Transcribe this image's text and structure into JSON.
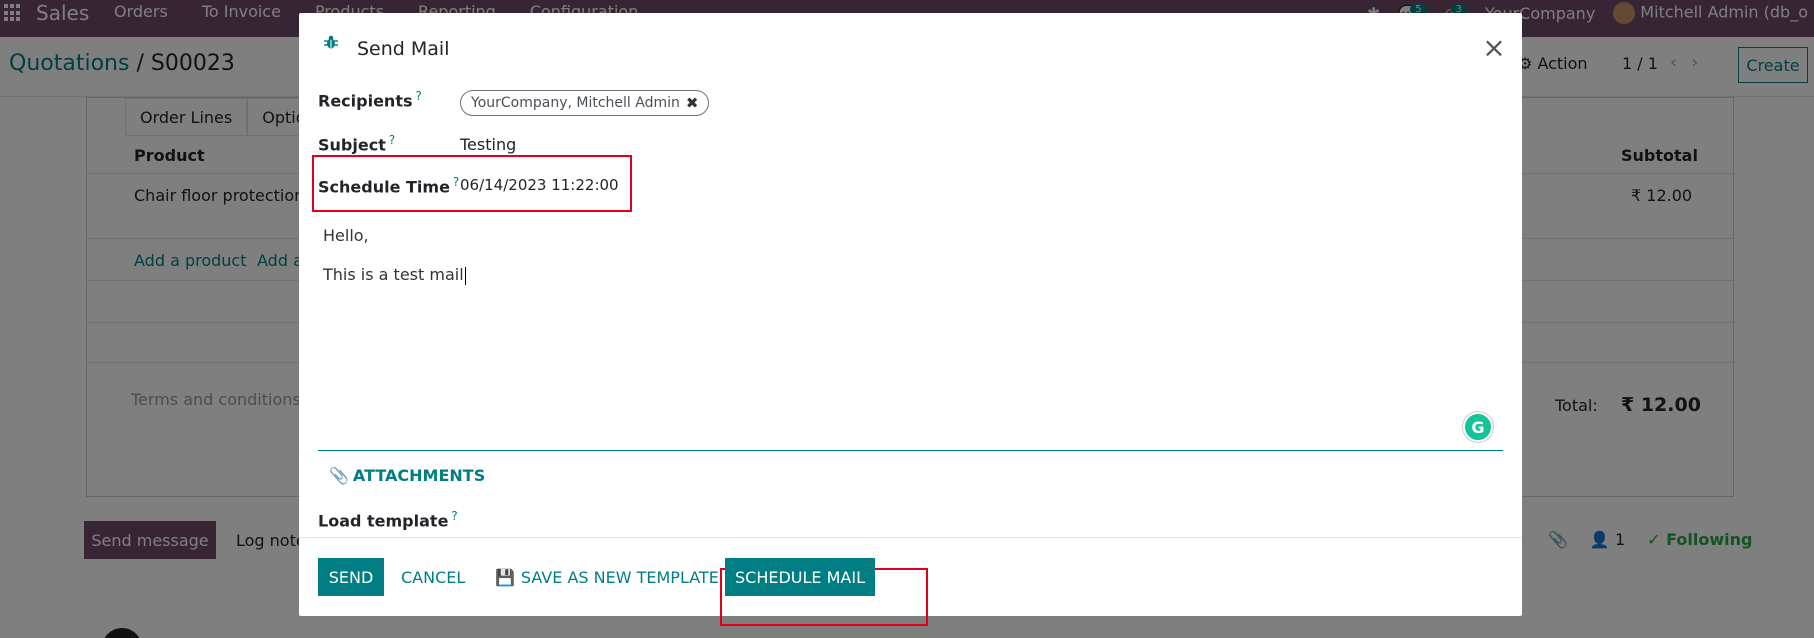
{
  "topbar": {
    "app_name": "Sales",
    "menu": [
      "Orders",
      "To Invoice",
      "Products",
      "Reporting",
      "Configuration"
    ],
    "messages_count": "5",
    "activities_count": "3",
    "company": "YourCompany",
    "user": "Mitchell Admin (db_o"
  },
  "control_panel": {
    "breadcrumb_parent": "Quotations",
    "breadcrumb_separator": "/",
    "breadcrumb_current": "S00023",
    "action_label": "Action",
    "pager": "1 / 1",
    "create_label": "Create"
  },
  "sheet": {
    "tabs": [
      "Order Lines",
      "Optio"
    ],
    "col_product": "Product",
    "col_subtotal": "Subtotal",
    "line_product": "Chair floor protection",
    "line_subtotal": "₹ 12.00",
    "add_product": "Add a product",
    "add_other": "Add a",
    "terms_placeholder": "Terms and conditions...",
    "total_label": "Total:",
    "total_value": "₹ 12.00"
  },
  "chatter": {
    "send_message": "Send message",
    "log_note": "Log note",
    "followers_count": "1",
    "following": "Following"
  },
  "modal": {
    "title": "Send Mail",
    "recipients_label": "Recipients",
    "recipient_tag": "YourCompany, Mitchell Admin",
    "subject_label": "Subject",
    "subject_value": "Testing",
    "schedule_label": "Schedule Time",
    "schedule_value": "06/14/2023 11:22:00",
    "body_line1": "Hello,",
    "body_line2": "This is a test mail",
    "attachments_label": "ATTACHMENTS",
    "load_template_label": "Load template",
    "help_mark": "?",
    "send_label": "SEND",
    "cancel_label": "CANCEL",
    "save_template_label": "SAVE AS NEW TEMPLATE",
    "schedule_mail_label": "SCHEDULE MAIL"
  },
  "colors": {
    "primary": "#017e84",
    "brand": "#714b67",
    "highlight": "#e0001b"
  }
}
